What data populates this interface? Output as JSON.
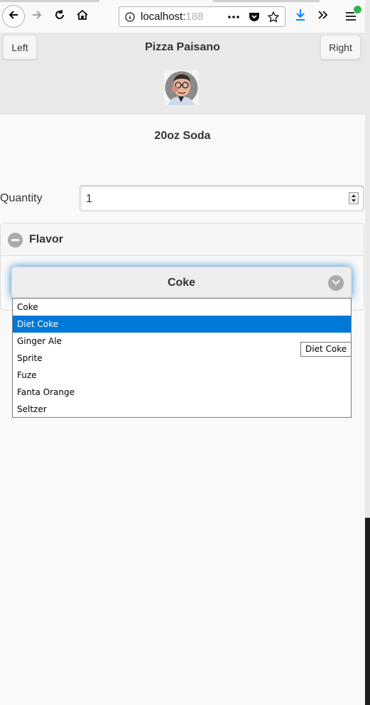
{
  "browser": {
    "url_host": "localhost:",
    "url_rest": "188"
  },
  "header": {
    "left_button": "Left",
    "right_button": "Right",
    "title": "Pizza Paisano"
  },
  "product": {
    "title": "20oz Soda"
  },
  "quantity": {
    "label": "Quantity",
    "value": "1"
  },
  "flavor": {
    "section_title": "Flavor",
    "selected": "Coke",
    "options": [
      "Coke",
      "Diet Coke",
      "Ginger Ale",
      "Sprite",
      "Fuze",
      "Fanta Orange",
      "Seltzer"
    ],
    "highlighted": "Diet Coke",
    "tooltip": "Diet Coke"
  },
  "colors": {
    "highlight": "#0078d7",
    "focus_glow": "#3388cc",
    "header_bg": "#e9e9e9"
  }
}
